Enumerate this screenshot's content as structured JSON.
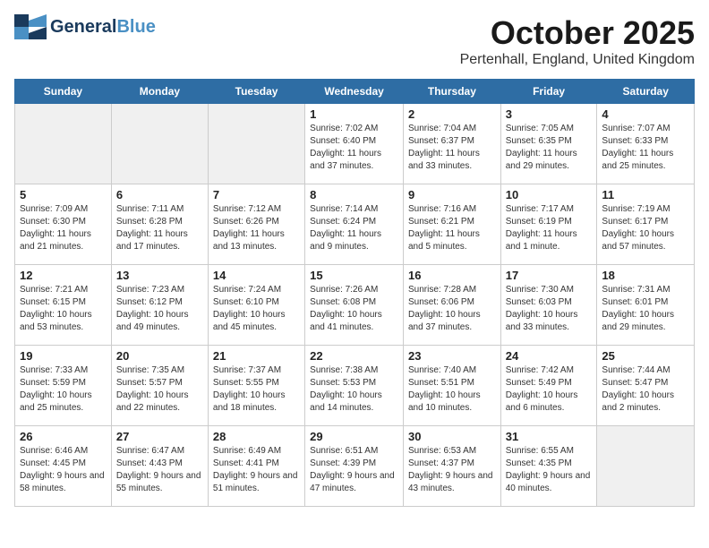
{
  "header": {
    "logo_general": "General",
    "logo_blue": "Blue",
    "month": "October 2025",
    "location": "Pertenhall, England, United Kingdom"
  },
  "days_of_week": [
    "Sunday",
    "Monday",
    "Tuesday",
    "Wednesday",
    "Thursday",
    "Friday",
    "Saturday"
  ],
  "weeks": [
    [
      {
        "day": "",
        "info": ""
      },
      {
        "day": "",
        "info": ""
      },
      {
        "day": "",
        "info": ""
      },
      {
        "day": "1",
        "info": "Sunrise: 7:02 AM\nSunset: 6:40 PM\nDaylight: 11 hours\nand 37 minutes."
      },
      {
        "day": "2",
        "info": "Sunrise: 7:04 AM\nSunset: 6:37 PM\nDaylight: 11 hours\nand 33 minutes."
      },
      {
        "day": "3",
        "info": "Sunrise: 7:05 AM\nSunset: 6:35 PM\nDaylight: 11 hours\nand 29 minutes."
      },
      {
        "day": "4",
        "info": "Sunrise: 7:07 AM\nSunset: 6:33 PM\nDaylight: 11 hours\nand 25 minutes."
      }
    ],
    [
      {
        "day": "5",
        "info": "Sunrise: 7:09 AM\nSunset: 6:30 PM\nDaylight: 11 hours\nand 21 minutes."
      },
      {
        "day": "6",
        "info": "Sunrise: 7:11 AM\nSunset: 6:28 PM\nDaylight: 11 hours\nand 17 minutes."
      },
      {
        "day": "7",
        "info": "Sunrise: 7:12 AM\nSunset: 6:26 PM\nDaylight: 11 hours\nand 13 minutes."
      },
      {
        "day": "8",
        "info": "Sunrise: 7:14 AM\nSunset: 6:24 PM\nDaylight: 11 hours\nand 9 minutes."
      },
      {
        "day": "9",
        "info": "Sunrise: 7:16 AM\nSunset: 6:21 PM\nDaylight: 11 hours\nand 5 minutes."
      },
      {
        "day": "10",
        "info": "Sunrise: 7:17 AM\nSunset: 6:19 PM\nDaylight: 11 hours\nand 1 minute."
      },
      {
        "day": "11",
        "info": "Sunrise: 7:19 AM\nSunset: 6:17 PM\nDaylight: 10 hours\nand 57 minutes."
      }
    ],
    [
      {
        "day": "12",
        "info": "Sunrise: 7:21 AM\nSunset: 6:15 PM\nDaylight: 10 hours\nand 53 minutes."
      },
      {
        "day": "13",
        "info": "Sunrise: 7:23 AM\nSunset: 6:12 PM\nDaylight: 10 hours\nand 49 minutes."
      },
      {
        "day": "14",
        "info": "Sunrise: 7:24 AM\nSunset: 6:10 PM\nDaylight: 10 hours\nand 45 minutes."
      },
      {
        "day": "15",
        "info": "Sunrise: 7:26 AM\nSunset: 6:08 PM\nDaylight: 10 hours\nand 41 minutes."
      },
      {
        "day": "16",
        "info": "Sunrise: 7:28 AM\nSunset: 6:06 PM\nDaylight: 10 hours\nand 37 minutes."
      },
      {
        "day": "17",
        "info": "Sunrise: 7:30 AM\nSunset: 6:03 PM\nDaylight: 10 hours\nand 33 minutes."
      },
      {
        "day": "18",
        "info": "Sunrise: 7:31 AM\nSunset: 6:01 PM\nDaylight: 10 hours\nand 29 minutes."
      }
    ],
    [
      {
        "day": "19",
        "info": "Sunrise: 7:33 AM\nSunset: 5:59 PM\nDaylight: 10 hours\nand 25 minutes."
      },
      {
        "day": "20",
        "info": "Sunrise: 7:35 AM\nSunset: 5:57 PM\nDaylight: 10 hours\nand 22 minutes."
      },
      {
        "day": "21",
        "info": "Sunrise: 7:37 AM\nSunset: 5:55 PM\nDaylight: 10 hours\nand 18 minutes."
      },
      {
        "day": "22",
        "info": "Sunrise: 7:38 AM\nSunset: 5:53 PM\nDaylight: 10 hours\nand 14 minutes."
      },
      {
        "day": "23",
        "info": "Sunrise: 7:40 AM\nSunset: 5:51 PM\nDaylight: 10 hours\nand 10 minutes."
      },
      {
        "day": "24",
        "info": "Sunrise: 7:42 AM\nSunset: 5:49 PM\nDaylight: 10 hours\nand 6 minutes."
      },
      {
        "day": "25",
        "info": "Sunrise: 7:44 AM\nSunset: 5:47 PM\nDaylight: 10 hours\nand 2 minutes."
      }
    ],
    [
      {
        "day": "26",
        "info": "Sunrise: 6:46 AM\nSunset: 4:45 PM\nDaylight: 9 hours\nand 58 minutes."
      },
      {
        "day": "27",
        "info": "Sunrise: 6:47 AM\nSunset: 4:43 PM\nDaylight: 9 hours\nand 55 minutes."
      },
      {
        "day": "28",
        "info": "Sunrise: 6:49 AM\nSunset: 4:41 PM\nDaylight: 9 hours\nand 51 minutes."
      },
      {
        "day": "29",
        "info": "Sunrise: 6:51 AM\nSunset: 4:39 PM\nDaylight: 9 hours\nand 47 minutes."
      },
      {
        "day": "30",
        "info": "Sunrise: 6:53 AM\nSunset: 4:37 PM\nDaylight: 9 hours\nand 43 minutes."
      },
      {
        "day": "31",
        "info": "Sunrise: 6:55 AM\nSunset: 4:35 PM\nDaylight: 9 hours\nand 40 minutes."
      },
      {
        "day": "",
        "info": ""
      }
    ]
  ]
}
